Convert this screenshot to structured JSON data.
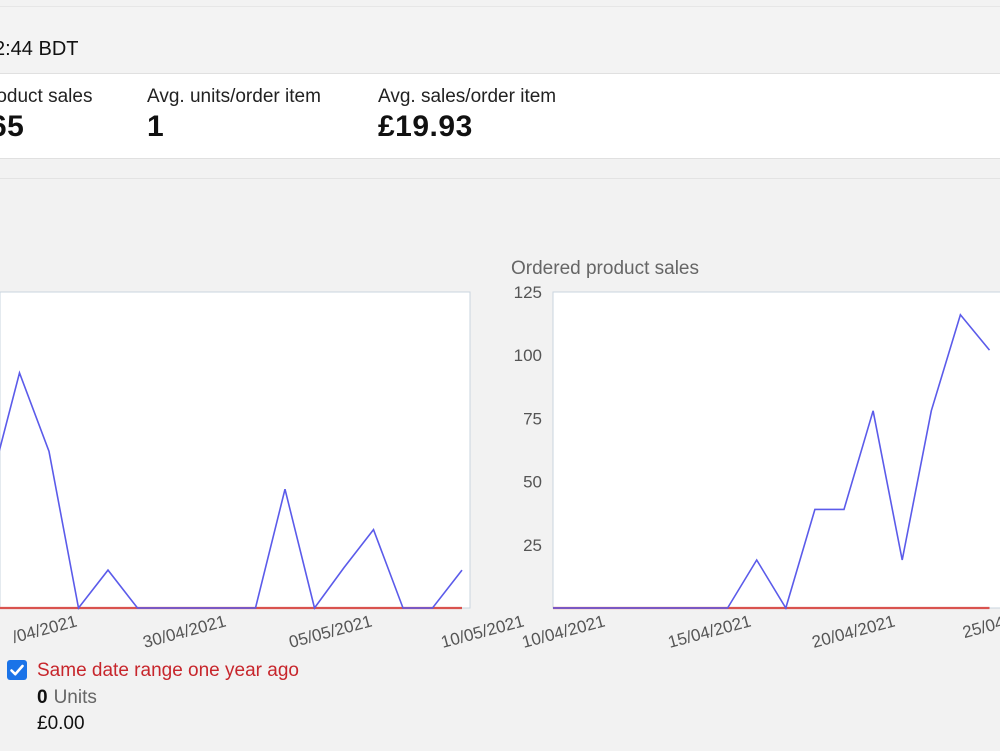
{
  "header": {
    "time_text": "2:44 BDT"
  },
  "metrics": [
    {
      "label": "roduct sales",
      "value": "65"
    },
    {
      "label": "Avg. units/order item",
      "value": "1"
    },
    {
      "label": "Avg. sales/order item",
      "value": "£19.93"
    }
  ],
  "legend": {
    "checkbox_checked": true,
    "last_year_label": "Same date range one year ago",
    "units_value": "0",
    "units_word": "Units",
    "sales_value": "£0.00"
  },
  "colors": {
    "current_series": "#5b5bea",
    "last_year_series": "#d9534f"
  },
  "chart_data": [
    {
      "type": "line",
      "title": "",
      "x_tick_labels": [
        "/04/2021",
        "30/04/2021",
        "05/05/2021",
        "10/05/2021"
      ],
      "series": [
        {
          "values": [
            48,
            93,
            62,
            0,
            15,
            0,
            0,
            0,
            0,
            0,
            47,
            0,
            16,
            31,
            0,
            0,
            15
          ]
        },
        {
          "values": [
            0,
            0,
            0,
            0,
            0,
            0,
            0,
            0,
            0,
            0,
            0,
            0,
            0,
            0,
            0,
            0,
            0
          ]
        }
      ]
    },
    {
      "type": "line",
      "title": "Ordered product sales",
      "ylim": [
        0,
        125
      ],
      "y_ticks": [
        25,
        50,
        75,
        100,
        125
      ],
      "x_tick_labels": [
        "10/04/2021",
        "15/04/2021",
        "20/04/2021",
        "25/04/"
      ],
      "series": [
        {
          "values": [
            0,
            0,
            0,
            0,
            0,
            0,
            0,
            19,
            0,
            39,
            39,
            78,
            19,
            78,
            116,
            102
          ]
        },
        {
          "values": [
            0,
            0,
            0,
            0,
            0,
            0,
            0,
            0,
            0,
            0,
            0,
            0,
            0,
            0,
            0,
            0
          ]
        }
      ]
    }
  ]
}
